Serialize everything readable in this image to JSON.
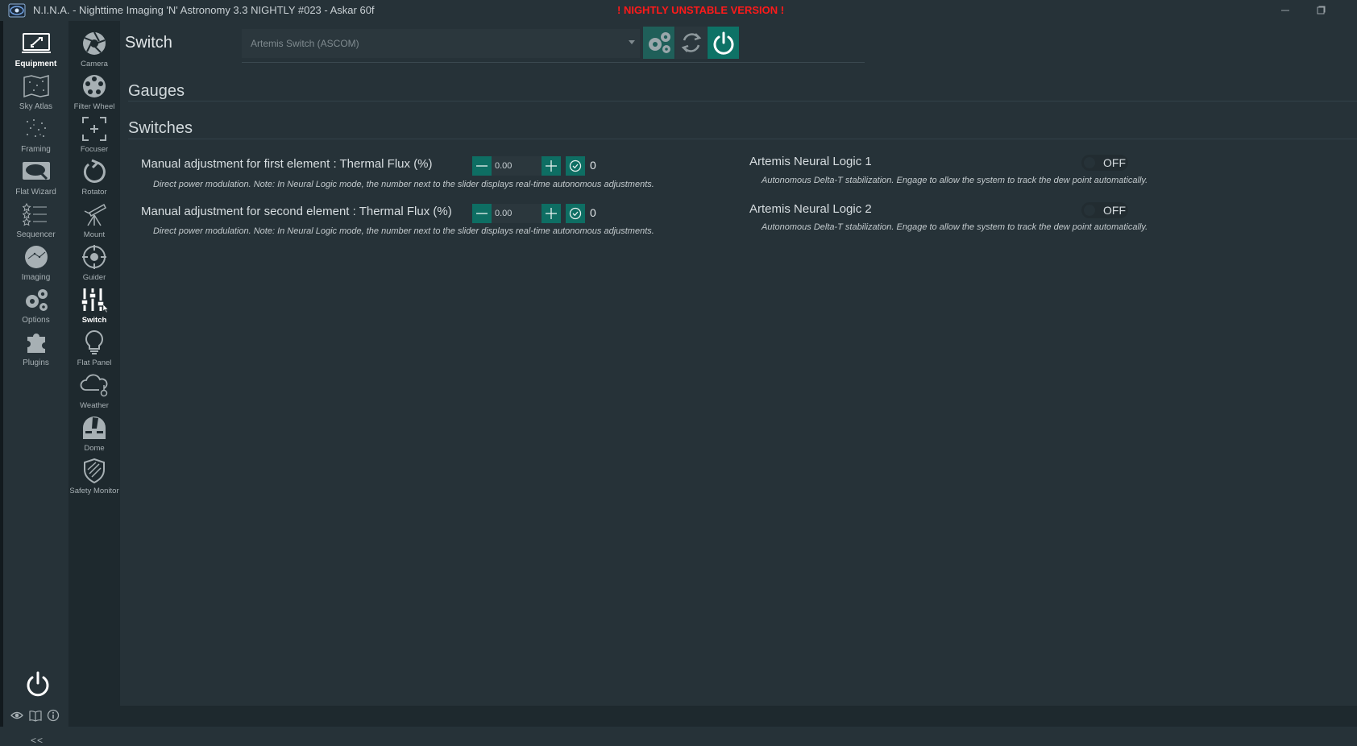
{
  "window": {
    "title": "N.I.N.A. - Nighttime Imaging 'N' Astronomy 3.3 NIGHTLY #023  -  Askar 60f",
    "warning": "! NIGHTLY UNSTABLE VERSION !",
    "minimize_icon": "minimize-icon",
    "maximize_icon": "maximize-icon"
  },
  "main_nav": [
    {
      "label": "Equipment",
      "icon": "equipment-icon",
      "active": true
    },
    {
      "label": "Sky Atlas",
      "icon": "sky-atlas-icon"
    },
    {
      "label": "Framing",
      "icon": "framing-icon"
    },
    {
      "label": "Flat Wizard",
      "icon": "flat-wizard-icon"
    },
    {
      "label": "Sequencer",
      "icon": "sequencer-icon"
    },
    {
      "label": "Imaging",
      "icon": "imaging-icon"
    },
    {
      "label": "Options",
      "icon": "options-icon"
    },
    {
      "label": "Plugins",
      "icon": "plugins-icon"
    }
  ],
  "sub_nav": [
    {
      "label": "Camera",
      "icon": "camera-icon"
    },
    {
      "label": "Filter Wheel",
      "icon": "filter-wheel-icon"
    },
    {
      "label": "Focuser",
      "icon": "focuser-icon"
    },
    {
      "label": "Rotator",
      "icon": "rotator-icon"
    },
    {
      "label": "Mount",
      "icon": "mount-icon"
    },
    {
      "label": "Guider",
      "icon": "guider-icon"
    },
    {
      "label": "Switch",
      "icon": "switch-icon",
      "active": true
    },
    {
      "label": "Flat Panel",
      "icon": "flat-panel-icon"
    },
    {
      "label": "Weather",
      "icon": "weather-icon"
    },
    {
      "label": "Dome",
      "icon": "dome-icon"
    },
    {
      "label": "Safety Monitor",
      "icon": "safety-monitor-icon"
    }
  ],
  "sidebar_footer": {
    "collapse_label": "<<"
  },
  "page": {
    "title": "Switch",
    "device_selected": "Artemis Switch (ASCOM)"
  },
  "sections": {
    "gauges_title": "Gauges",
    "switches_title": "Switches"
  },
  "writable_switches": [
    {
      "label": "Manual adjustment for first element : Thermal Flux (%)",
      "description": "Direct power modulation. Note: In Neural Logic mode, the number next to the slider displays real-time autonomous adjustments.",
      "input_value": "0.00",
      "current_value": "0"
    },
    {
      "label": "Manual adjustment for second element : Thermal Flux (%)",
      "description": "Direct power modulation. Note: In Neural Logic mode, the number next to the slider displays real-time autonomous adjustments.",
      "input_value": "0.00",
      "current_value": "0"
    }
  ],
  "toggle_switches": [
    {
      "label": "Artemis Neural Logic 1",
      "description": "Autonomous Delta-T stabilization. Engage to allow the system to track the dew point automatically.",
      "state": "OFF"
    },
    {
      "label": "Artemis Neural Logic 2",
      "description": "Autonomous Delta-T stabilization. Engage to allow the system to track the dew point automatically.",
      "state": "OFF"
    }
  ],
  "colors": {
    "background": "#263238",
    "sidebar": "#1e292e",
    "accent": "#0e7266",
    "warning": "#ff1a1a"
  }
}
